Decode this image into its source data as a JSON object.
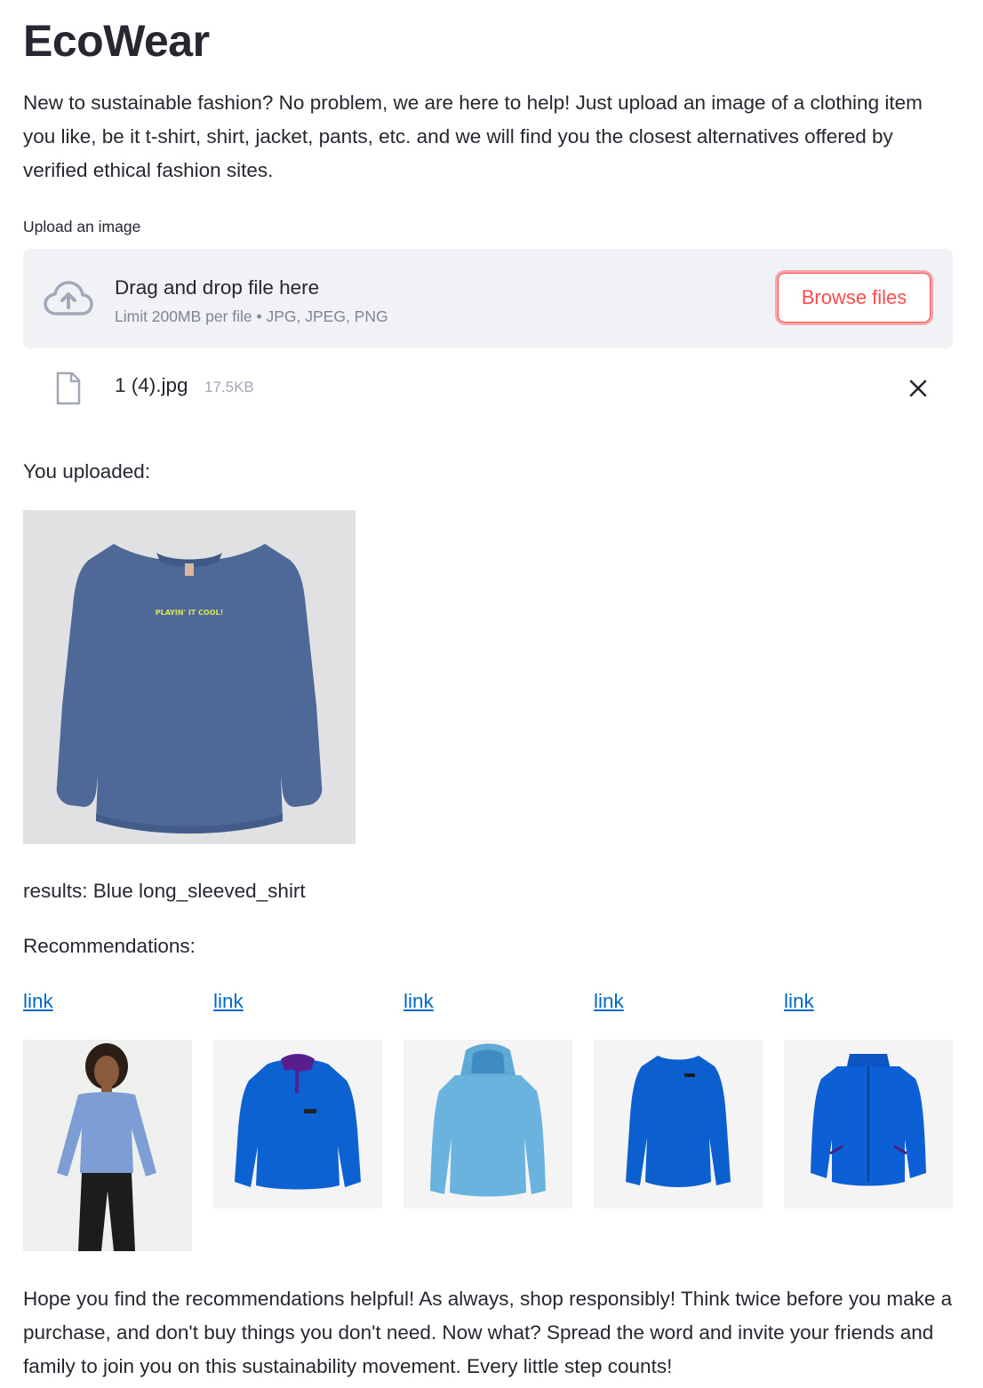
{
  "app": {
    "title": "EcoWear",
    "intro": "New to sustainable fashion? No problem, we are here to help! Just upload an image of a clothing item you like, be it t-shirt, shirt, jacket, pants, etc. and we will find you the closest alternatives offered by verified ethical fashion sites."
  },
  "uploader": {
    "label": "Upload an image",
    "drop_title": "Drag and drop file here",
    "drop_limit": "Limit 200MB per file • JPG, JPEG, PNG",
    "browse_label": "Browse files",
    "accent_color": "#ff4b4b",
    "file": {
      "name": "1 (4).jpg",
      "size": "17.5KB"
    }
  },
  "uploaded": {
    "heading": "You uploaded:",
    "image_text": "PLAYIN' IT COOL!"
  },
  "results": {
    "text": "results: Blue long_sleeved_shirt"
  },
  "recommendations": {
    "heading": "Recommendations:",
    "items": [
      {
        "link_label": "link"
      },
      {
        "link_label": "link"
      },
      {
        "link_label": "link"
      },
      {
        "link_label": "link"
      },
      {
        "link_label": "link"
      }
    ]
  },
  "outro": "Hope you find the recommendations helpful! As always, shop responsibly! Think twice before you make a purchase, and don't buy things you don't need. Now what? Spread the word and invite your friends and family to join you on this sustainability movement. Every little step counts!"
}
